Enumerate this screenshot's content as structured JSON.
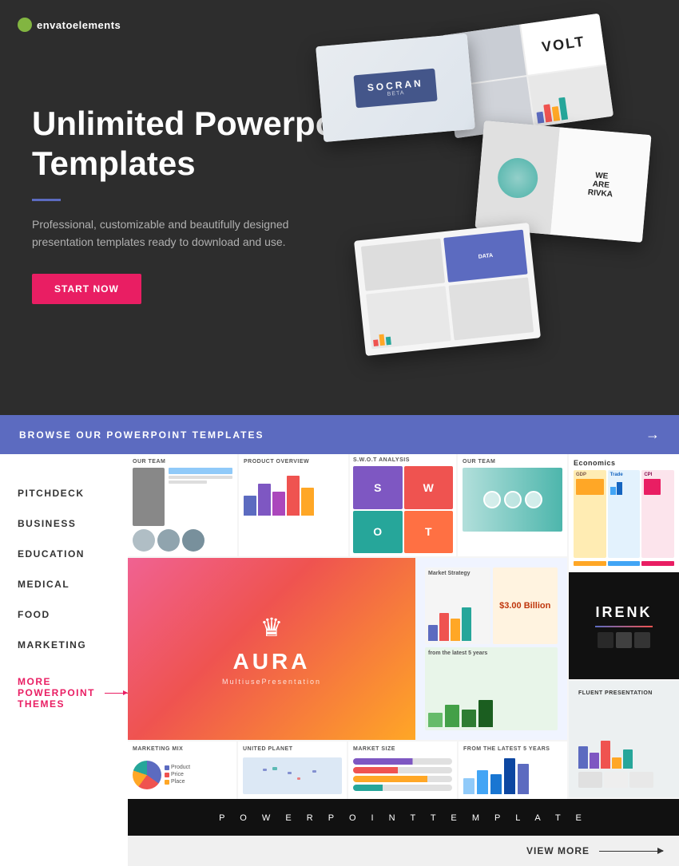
{
  "hero": {
    "logo": {
      "text": "envato",
      "subtext": "elements"
    },
    "title": "Unlimited Powerpoint Templates",
    "description": "Professional, customizable and beautifully designed presentation templates ready to download and use.",
    "cta_button": "START NOW",
    "mockup_cards": [
      {
        "label": "VOLT"
      },
      {
        "label": "SOCRAN"
      },
      {
        "label": "WE ARE RIVKA"
      }
    ]
  },
  "browse": {
    "title": "BROWSE OUR POWERPOINT TEMPLATES",
    "arrow": "→"
  },
  "sidebar": {
    "items": [
      {
        "label": "PITCHDECK"
      },
      {
        "label": "BUSINESS"
      },
      {
        "label": "EDUCATION"
      },
      {
        "label": "MEDICAL"
      },
      {
        "label": "FOOD"
      },
      {
        "label": "MARKETING"
      }
    ],
    "more_label": "MORE POWERPOINT THEMES"
  },
  "templates": {
    "row1": [
      {
        "title": "Our Team"
      },
      {
        "title": "Product Overview"
      },
      {
        "title": "S.W.O.T Analysis"
      },
      {
        "title": "OUR TEAM"
      }
    ],
    "featured": {
      "title": "AURA",
      "subtitle": "MultiusePresentation"
    },
    "row3": [
      {
        "title": "Marketing Mix"
      },
      {
        "title": "United Planet"
      },
      {
        "title": "Market Size"
      },
      {
        "title": "from the latest 5 years"
      }
    ],
    "right_cards": [
      {
        "title": "Economics",
        "type": "light"
      },
      {
        "title": "IRENK",
        "type": "dark"
      },
      {
        "title": "FLUENT PRESENTATION",
        "type": "mid"
      }
    ]
  },
  "ppt_bar": {
    "text": "P O W E R P O I N T   T E M P L A T E"
  },
  "view_more": {
    "label": "VIEW MORE"
  }
}
